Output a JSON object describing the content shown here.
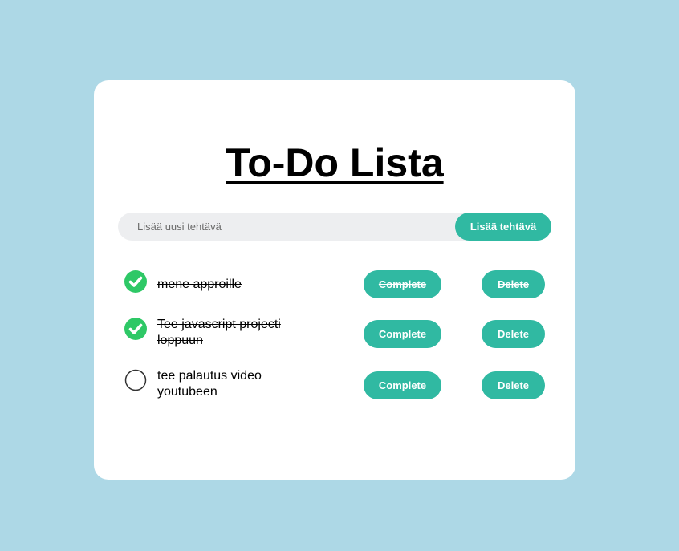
{
  "title": "To-Do Lista",
  "colors": {
    "page_background": "#add8e6",
    "accent": "#30b9a2",
    "done_check": "#2ec866",
    "input_background": "#edeef0"
  },
  "add_form": {
    "placeholder": "Lisää uusi tehtävä",
    "value": "",
    "button_label": "Lisää tehtävä"
  },
  "tasks": [
    {
      "text": "mene approille",
      "completed": true,
      "complete_label": "Complete",
      "delete_label": "Delete"
    },
    {
      "text": "Tee javascript projecti loppuun",
      "completed": true,
      "complete_label": "Complete",
      "delete_label": "Delete"
    },
    {
      "text": "tee palautus video youtubeen",
      "completed": false,
      "complete_label": "Complete",
      "delete_label": "Delete"
    }
  ],
  "icons": {
    "checked": "check-circle-icon",
    "unchecked": "empty-circle-icon"
  }
}
